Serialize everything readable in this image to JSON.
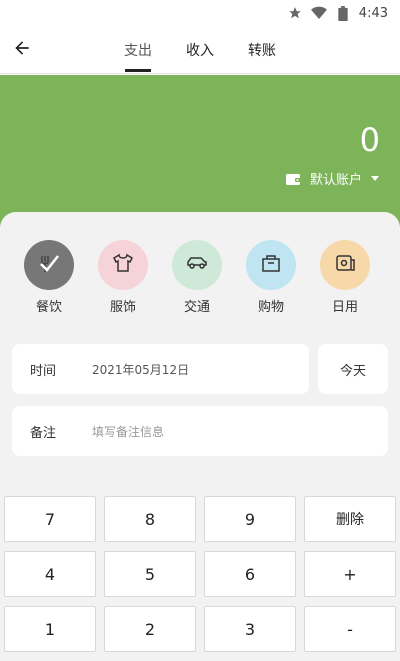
{
  "status_bar": {
    "time": "4:43",
    "icons": [
      "star-icon",
      "wifi-icon",
      "battery-icon"
    ]
  },
  "topbar": {
    "back_icon": "arrow-left-icon",
    "tabs": [
      {
        "label": "支出",
        "active": true
      },
      {
        "label": "收入",
        "active": false
      },
      {
        "label": "转账",
        "active": false
      }
    ]
  },
  "header": {
    "amount": "0",
    "account": "默认账户",
    "accent_color": "#7db45a"
  },
  "categories": [
    {
      "label": "餐饮",
      "icon": "checkmark-icon",
      "bg": "#777777",
      "selected": true
    },
    {
      "label": "服饰",
      "icon": "shirt-icon",
      "bg": "#f6d3d8",
      "selected": false
    },
    {
      "label": "交通",
      "icon": "car-icon",
      "bg": "#cfe9d9",
      "selected": false
    },
    {
      "label": "购物",
      "icon": "shopping-bag-icon",
      "bg": "#bfe4f2",
      "selected": false
    },
    {
      "label": "日用",
      "icon": "toilet-paper-icon",
      "bg": "#f7d8a8",
      "selected": false
    }
  ],
  "form": {
    "time_label": "时间",
    "time_value": "2021年05月12日",
    "today_label": "今天",
    "note_label": "备注",
    "note_placeholder": "填写备注信息"
  },
  "keypad": {
    "rows": [
      [
        "7",
        "8",
        "9",
        "删除"
      ],
      [
        "4",
        "5",
        "6",
        "+"
      ],
      [
        "1",
        "2",
        "3",
        "-"
      ]
    ]
  }
}
